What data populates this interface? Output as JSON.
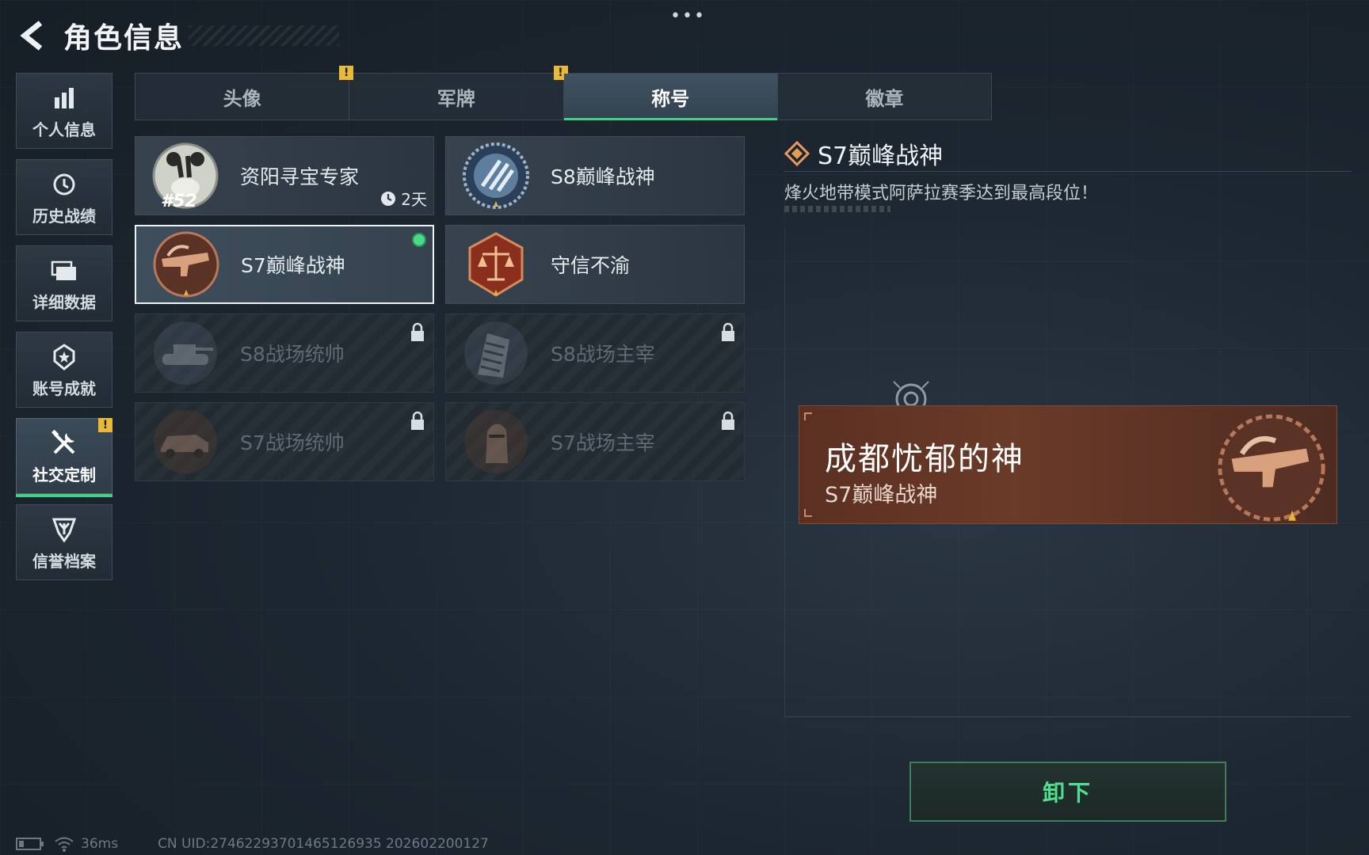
{
  "header": {
    "title": "角色信息",
    "menu": "•••"
  },
  "sidebar": {
    "items": [
      {
        "label": "个人信息"
      },
      {
        "label": "历史战绩"
      },
      {
        "label": "详细数据"
      },
      {
        "label": "账号成就"
      },
      {
        "label": "社交定制",
        "active": true,
        "alert": "!"
      },
      {
        "label": "信誉档案"
      }
    ]
  },
  "tabs": [
    {
      "label": "头像",
      "alert": "!"
    },
    {
      "label": "军牌",
      "alert": "!"
    },
    {
      "label": "称号",
      "active": true
    },
    {
      "label": "徽章"
    }
  ],
  "titles": [
    {
      "name": "资阳寻宝专家",
      "rank": "#52",
      "timer": "2天"
    },
    {
      "name": "S8巅峰战神"
    },
    {
      "name": "S7巅峰战神",
      "selected": true,
      "equipped": true
    },
    {
      "name": "守信不渝"
    },
    {
      "name": "S8战场统帅",
      "locked": true
    },
    {
      "name": "S8战场主宰",
      "locked": true
    },
    {
      "name": "S7战场统帅",
      "locked": true
    },
    {
      "name": "S7战场主宰",
      "locked": true
    }
  ],
  "detail": {
    "name": "S7巅峰战神",
    "description": "烽火地带模式阿萨拉赛季达到最高段位！",
    "preview": {
      "nickname": "成都忧郁的神",
      "title": "S7巅峰战神"
    }
  },
  "actions": {
    "unequip": "卸下"
  },
  "footer": {
    "ping": "36ms",
    "uid": "CN UID:274622937014651269​35 202602200127"
  },
  "colors": {
    "accent": "#3fd385",
    "alert": "#e9b93a",
    "banner": "#6b3a28"
  }
}
